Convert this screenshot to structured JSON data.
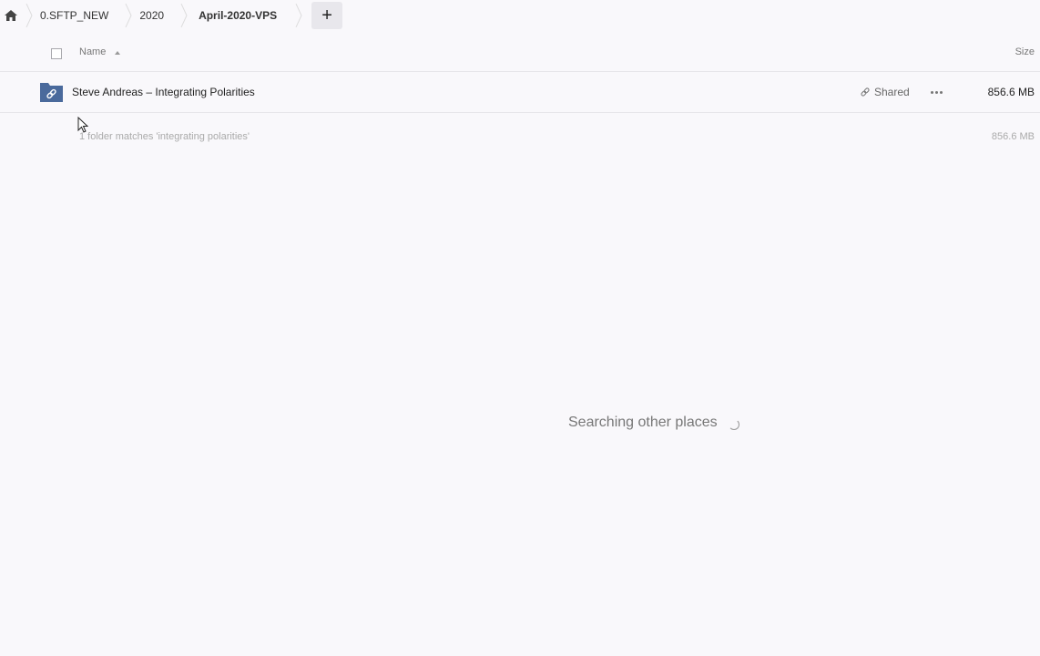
{
  "breadcrumb": {
    "home_icon": "home-icon",
    "items": [
      {
        "label": "0.SFTP_NEW"
      },
      {
        "label": "2020"
      },
      {
        "label": "April-2020-VPS"
      }
    ],
    "add_label": "+"
  },
  "table": {
    "columns": {
      "name": "Name",
      "size": "Size"
    },
    "sort": "name-ascending",
    "rows": [
      {
        "name": "Steve Andreas – Integrating Polarities",
        "icon": "shared-folder-icon",
        "shared_label": "Shared",
        "size": "856.6 MB"
      }
    ],
    "summary": {
      "text": "1 folder matches 'integrating polarities'",
      "size": "856.6 MB"
    }
  },
  "status": {
    "searching_text": "Searching other places"
  },
  "colors": {
    "background": "#f9f8fb",
    "folder_blue": "#4a6a9c",
    "add_button_bg": "#e8e7ec"
  }
}
